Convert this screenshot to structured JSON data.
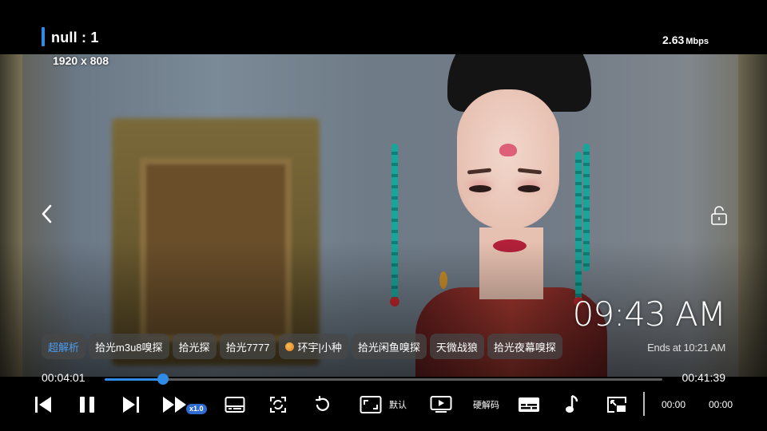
{
  "header": {
    "title": "null : 1",
    "net_speed_value": "2.63",
    "net_speed_unit": "Mbps",
    "resolution": "1920 x 808"
  },
  "overlay": {
    "clock": "09:43 AM",
    "ends_at": "Ends at 10:21 AM",
    "back_icon": "chevron-left-icon",
    "lock_icon": "unlock-icon"
  },
  "sources": [
    {
      "label": "超解析",
      "active": true
    },
    {
      "label": "拾光m3u8嗅探",
      "active": false
    },
    {
      "label": "拾光探",
      "active": false
    },
    {
      "label": "拾光7777",
      "active": false
    },
    {
      "label": "环宇|小种",
      "active": false,
      "icon": "sun-emoji-icon"
    },
    {
      "label": "拾光闲鱼嗅探",
      "active": false
    },
    {
      "label": "天微战狼",
      "active": false
    },
    {
      "label": "拾光夜幕嗅探",
      "active": false
    }
  ],
  "playback": {
    "current_time": "00:04:01",
    "total_time": "00:41:39",
    "progress": 0.1045,
    "accent": "#2f8ae8"
  },
  "controls": {
    "speed_badge": "x1.0",
    "scale_label": "默认",
    "decoder_label": "硬解码",
    "opening_skip": "00:00",
    "ending_skip": "00:00",
    "icons": [
      "skip-previous-icon",
      "pause-icon",
      "skip-next-icon",
      "fast-forward-icon",
      "subtitle-panel-icon",
      "rotate-screen-icon",
      "replay-icon",
      "aspect-ratio-icon",
      "player-type-icon",
      "subtitles-icon",
      "audio-track-icon",
      "picture-in-picture-icon"
    ]
  }
}
